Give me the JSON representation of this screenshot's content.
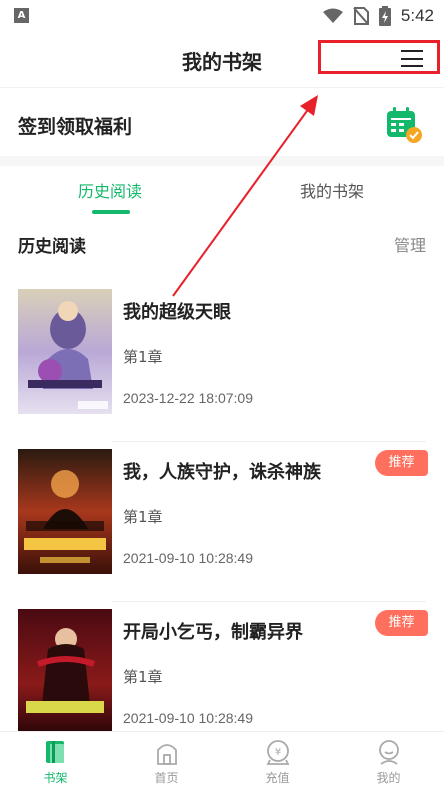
{
  "status_bar": {
    "app_icon_letter": "A",
    "time": "5:42"
  },
  "header": {
    "title": "我的书架"
  },
  "checkin": {
    "label": "签到领取福利"
  },
  "tabs": [
    {
      "label": "历史阅读",
      "active": true
    },
    {
      "label": "我的书架",
      "active": false
    }
  ],
  "section": {
    "title": "历史阅读",
    "manage_label": "管理"
  },
  "books": [
    {
      "title": "我的超级天眼",
      "chapter": "第1章",
      "last_read": "2023-12-22 18:07:09",
      "badge": ""
    },
    {
      "title": "我，人族守护，诛杀神族",
      "chapter": "第1章",
      "last_read": "2021-09-10 10:28:49",
      "badge": "推荐"
    },
    {
      "title": "开局小乞丐，制霸异界",
      "chapter": "第1章",
      "last_read": "2021-09-10 10:28:49",
      "badge": "推荐"
    }
  ],
  "bottom_nav": [
    {
      "label": "书架",
      "icon": "bookshelf-icon",
      "active": true
    },
    {
      "label": "首页",
      "icon": "home-icon",
      "active": false
    },
    {
      "label": "充值",
      "icon": "recharge-icon",
      "active": false
    },
    {
      "label": "我的",
      "icon": "profile-icon",
      "active": false
    }
  ],
  "colors": {
    "accent": "#13b86a",
    "badge": "#ff6f5e",
    "annotation": "#e8202a"
  }
}
